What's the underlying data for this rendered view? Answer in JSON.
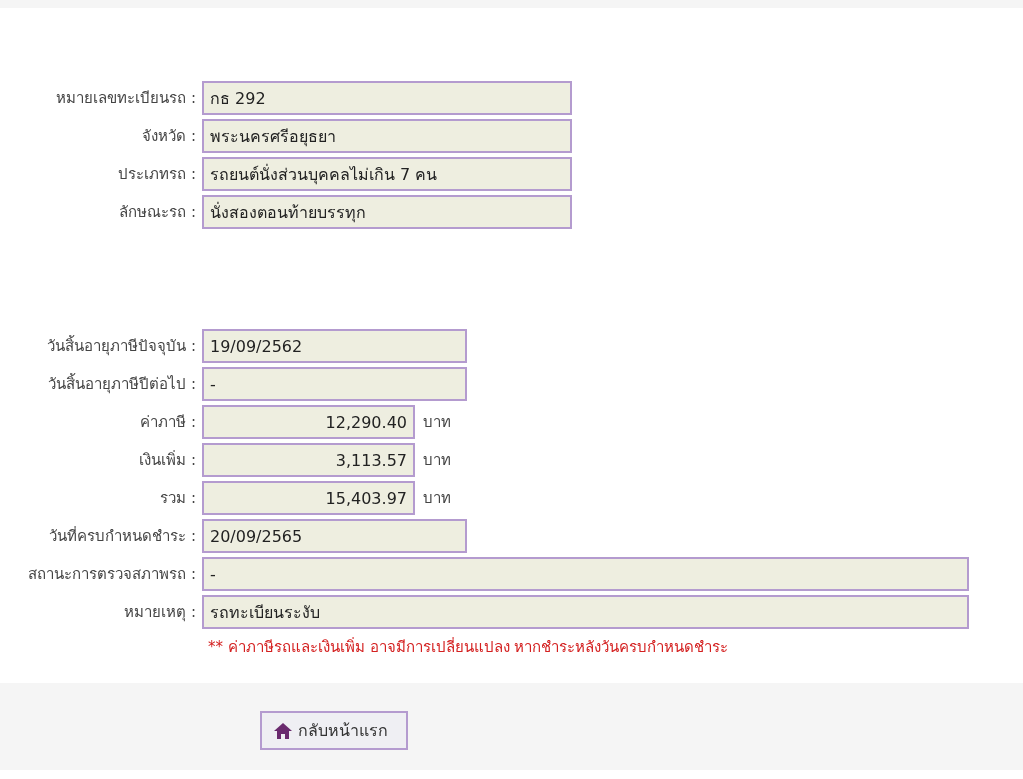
{
  "vehicle": [
    {
      "label": "หมายเลขทะเบียนรถ :",
      "value": "กธ 292",
      "kind": "text"
    },
    {
      "label": "จังหวัด :",
      "value": "พระนครศรีอยุธยา",
      "kind": "text"
    },
    {
      "label": "ประเภทรถ :",
      "value": "รถยนต์นั่งส่วนบุคคลไม่เกิน 7 คน",
      "kind": "text"
    },
    {
      "label": "ลักษณะรถ :",
      "value": "นั่งสองตอนท้ายบรรทุก",
      "kind": "text"
    }
  ],
  "tax": [
    {
      "label": "วันสิ้นอายุภาษีปัจจุบัน :",
      "value": "19/09/2562",
      "kind": "date"
    },
    {
      "label": "วันสิ้นอายุภาษีปีต่อไป :",
      "value": "-",
      "kind": "date"
    },
    {
      "label": "ค่าภาษี :",
      "value": "12,290.40",
      "kind": "amount",
      "unit": "บาท"
    },
    {
      "label": "เงินเพิ่ม :",
      "value": "3,113.57",
      "kind": "amount",
      "unit": "บาท"
    },
    {
      "label": "รวม :",
      "value": "15,403.97",
      "kind": "amount",
      "unit": "บาท"
    },
    {
      "label": "วันที่ครบกำหนดชำระ :",
      "value": "20/09/2565",
      "kind": "date"
    },
    {
      "label": "สถานะการตรวจสภาพรถ :",
      "value": "-",
      "kind": "long"
    },
    {
      "label": "หมายเหตุ :",
      "value": "รถทะเบียนระงับ",
      "kind": "long"
    }
  ],
  "note": "** ค่าภาษีรถและเงินเพิ่ม อาจมีการเปลี่ยนแปลง หากชำระหลังวันครบกำหนดชำระ",
  "home_button": "กลับหน้าแรก"
}
